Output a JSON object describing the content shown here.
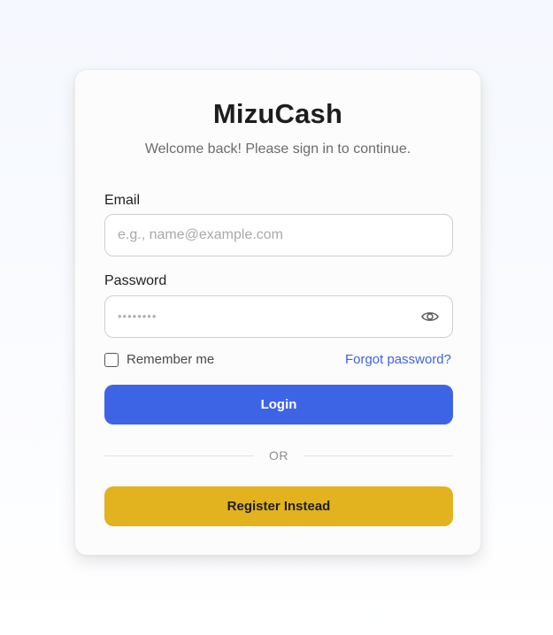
{
  "app": {
    "title": "MizuCash",
    "subtitle": "Welcome back! Please sign in to continue."
  },
  "form": {
    "email": {
      "label": "Email",
      "placeholder": "e.g., name@example.com",
      "value": ""
    },
    "password": {
      "label": "Password",
      "placeholder": "••••••••",
      "value": "",
      "toggle_icon": "eye-icon"
    },
    "remember": {
      "label": "Remember me",
      "checked": false
    },
    "forgot_link": "Forgot password?",
    "login_label": "Login",
    "divider_text": "OR",
    "register_label": "Register Instead"
  },
  "colors": {
    "primary": "#3e64e6",
    "secondary": "#e2b21f",
    "link": "#3d63e0"
  }
}
